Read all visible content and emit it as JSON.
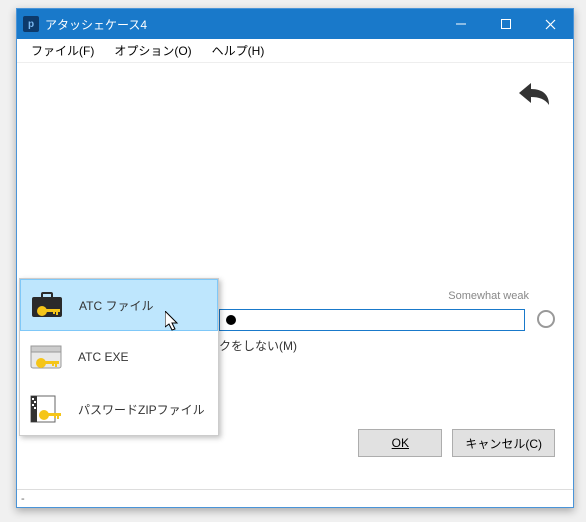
{
  "titlebar": {
    "app_title": "アタッシェケース4"
  },
  "menubar": {
    "file": "ファイル(F)",
    "option": "オプション(O)",
    "help": "ヘルプ(H)"
  },
  "content": {
    "strength_label": "Somewhat weak",
    "mask_checkbox_partial": "クをしない(M)"
  },
  "popup": {
    "items": [
      {
        "label": "ATC ファイル"
      },
      {
        "label": "ATC EXE"
      },
      {
        "label": "パスワードZIPファイル"
      }
    ]
  },
  "buttons": {
    "ok": "OK",
    "cancel": "キャンセル(C)"
  },
  "statusbar": {
    "text": "-"
  }
}
